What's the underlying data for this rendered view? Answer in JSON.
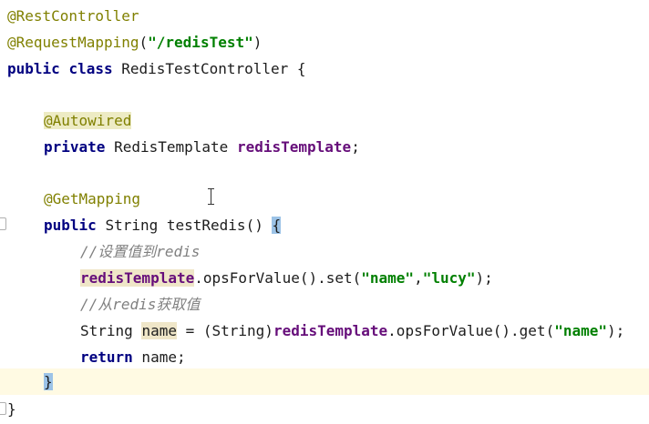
{
  "editor": {
    "lines": {
      "l1": {
        "anno": "@RestController"
      },
      "l2": {
        "anno": "@RequestMapping",
        "open": "(",
        "str": "\"/redisTest\"",
        "close": ")"
      },
      "l3": {
        "kw1": "public",
        "kw2": "class",
        "name": "RedisTestController",
        "brace": "{"
      },
      "l5": {
        "anno": "@Autowired"
      },
      "l6": {
        "kw": "private",
        "type": "RedisTemplate",
        "field": "redisTemplate",
        "semi": ";"
      },
      "l8": {
        "anno": "@GetMapping"
      },
      "l9": {
        "kw": "public",
        "sig": "String testRedis()",
        "brace": "{"
      },
      "l10": {
        "comment": "//设置值到redis"
      },
      "l11": {
        "field": "redisTemplate",
        "call": ".opsForValue().set(",
        "str1": "\"name\"",
        "comma": ",",
        "str2": "\"lucy\"",
        "end": ");"
      },
      "l12": {
        "comment": "//从redis获取值"
      },
      "l13": {
        "type": "String ",
        "var": "name",
        "mid": " = (String)",
        "field": "redisTemplate",
        "call": ".opsForValue().get(",
        "str": "\"name\"",
        "end": ");"
      },
      "l14": {
        "kw": "return",
        "rest": " name;"
      },
      "l15": {
        "brace": "}"
      },
      "l16": {
        "brace": "}"
      }
    }
  }
}
